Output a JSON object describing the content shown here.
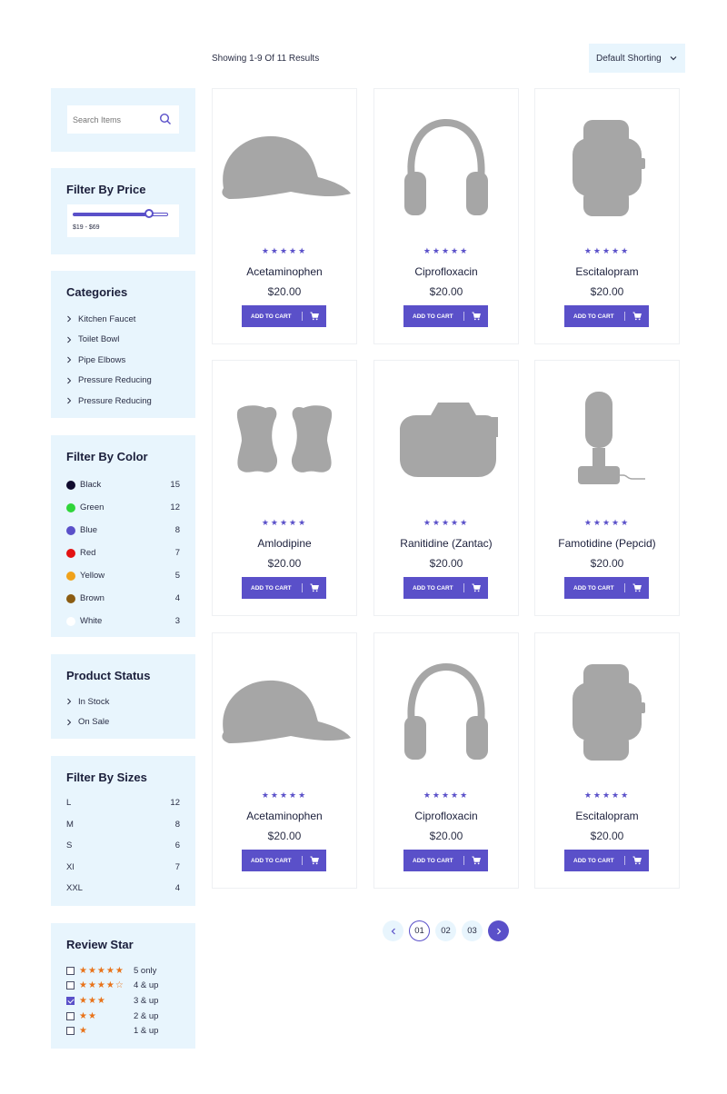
{
  "toolbar": {
    "results_text": "Showing 1-9 Of 11 Results",
    "sort_label": "Default Shorting"
  },
  "search": {
    "placeholder": "Search Items"
  },
  "price_filter": {
    "title": "Filter By Price",
    "range_text": "$19 - $69",
    "slider_fraction": 0.8
  },
  "categories": {
    "title": "Categories",
    "items": [
      "Kitchen Faucet",
      "Toilet Bowl",
      "Pipe Elbows",
      "Pressure Reducing",
      "Pressure Reducing"
    ]
  },
  "color_filter": {
    "title": "Filter By Color",
    "items": [
      {
        "name": "Black",
        "count": "15",
        "color": "#0f0b2e"
      },
      {
        "name": "Green",
        "count": "12",
        "color": "#2fd53a"
      },
      {
        "name": "Blue",
        "count": "8",
        "color": "#5a50c9"
      },
      {
        "name": "Red",
        "count": "7",
        "color": "#e31212"
      },
      {
        "name": "Yellow",
        "count": "5",
        "color": "#f0a21b"
      },
      {
        "name": "Brown",
        "count": "4",
        "color": "#8b5c12"
      },
      {
        "name": "White",
        "count": "3",
        "color": "#ffffff"
      }
    ]
  },
  "status_filter": {
    "title": "Product Status",
    "items": [
      "In Stock",
      "On Sale"
    ]
  },
  "size_filter": {
    "title": "Filter By Sizes",
    "items": [
      {
        "name": "L",
        "count": "12"
      },
      {
        "name": "M",
        "count": "8"
      },
      {
        "name": "S",
        "count": "6"
      },
      {
        "name": "Xl",
        "count": "7"
      },
      {
        "name": "XXL",
        "count": "4"
      }
    ]
  },
  "review_filter": {
    "title": "Review Star",
    "items": [
      {
        "stars": "★★★★★",
        "label": "5 only",
        "checked": false
      },
      {
        "stars": "★★★★☆",
        "label": "4 & up",
        "checked": false
      },
      {
        "stars": "★★★",
        "label": "3 & up",
        "checked": true
      },
      {
        "stars": "★★",
        "label": "2 & up",
        "checked": false
      },
      {
        "stars": "★",
        "label": "1 & up",
        "checked": false
      }
    ]
  },
  "products": [
    {
      "name": "Acetaminophen",
      "price": "$20.00",
      "rating": "★★★★★",
      "image": "cap-icon"
    },
    {
      "name": "Ciprofloxacin",
      "price": "$20.00",
      "rating": "★★★★★",
      "image": "headphones-icon"
    },
    {
      "name": "Escitalopram",
      "price": "$20.00",
      "rating": "★★★★★",
      "image": "smartwatch-icon"
    },
    {
      "name": "Amlodipine",
      "price": "$20.00",
      "rating": "★★★★★",
      "image": "gamepad-icon"
    },
    {
      "name": "Ranitidine (Zantac)",
      "price": "$20.00",
      "rating": "★★★★★",
      "image": "camera-icon"
    },
    {
      "name": "Famotidine (Pepcid)",
      "price": "$20.00",
      "rating": "★★★★★",
      "image": "microphone-icon"
    },
    {
      "name": "Acetaminophen",
      "price": "$20.00",
      "rating": "★★★★★",
      "image": "cap-icon"
    },
    {
      "name": "Ciprofloxacin",
      "price": "$20.00",
      "rating": "★★★★★",
      "image": "headphones-icon"
    },
    {
      "name": "Escitalopram",
      "price": "$20.00",
      "rating": "★★★★★",
      "image": "smartwatch-icon"
    }
  ],
  "cart_label": "ADD TO CART",
  "pagination": {
    "pages": [
      "01",
      "02",
      "03"
    ],
    "current": "01"
  },
  "colors": {
    "accent": "#5a50c9",
    "panel_bg": "#e8f5fd",
    "star_orange": "#e8731a",
    "image_gray": "#a6a6a6"
  }
}
